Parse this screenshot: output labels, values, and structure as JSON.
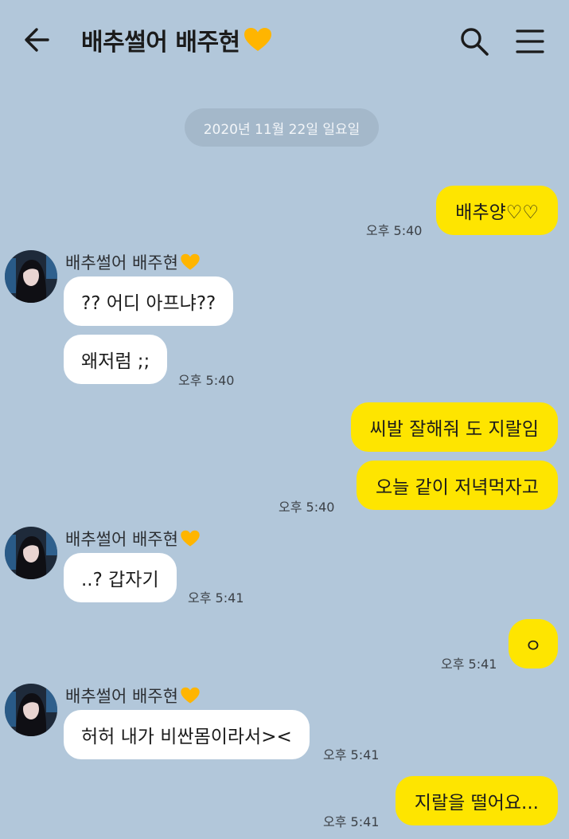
{
  "header": {
    "title": "배추썰어 배주현",
    "back_icon": "arrow-left-icon",
    "search_icon": "search-icon",
    "menu_icon": "menu-icon",
    "heart_color": "#ffb500"
  },
  "date_divider": "2020년 11월 22일 일요일",
  "contact_name": "배추썰어 배주현",
  "colors": {
    "background": "#b2c7da",
    "my_bubble": "#fee500",
    "their_bubble": "#ffffff"
  },
  "messages": [
    {
      "from": "me",
      "text": "배추양♡♡"
    },
    {
      "from": "me",
      "time": "오후 5:40"
    },
    {
      "from": "them",
      "text": "?? 어디 아프냐??"
    },
    {
      "from": "them",
      "text": "왜저럼 ;;",
      "time": "오후 5:40"
    },
    {
      "from": "me",
      "text": "씨발 잘해줘 도 지랄임"
    },
    {
      "from": "me",
      "text": "오늘 같이 저녁먹자고",
      "time": "오후 5:40"
    },
    {
      "from": "them",
      "text": "..? 갑자기",
      "time": "오후 5:41"
    },
    {
      "from": "me",
      "text": "ㅇ",
      "time": "오후 5:41"
    },
    {
      "from": "them",
      "text": "허허 내가 비싼몸이라서><",
      "time": "오후 5:41"
    },
    {
      "from": "me",
      "text": "지랄을 떨어요...",
      "time": "오후 5:41"
    }
  ]
}
